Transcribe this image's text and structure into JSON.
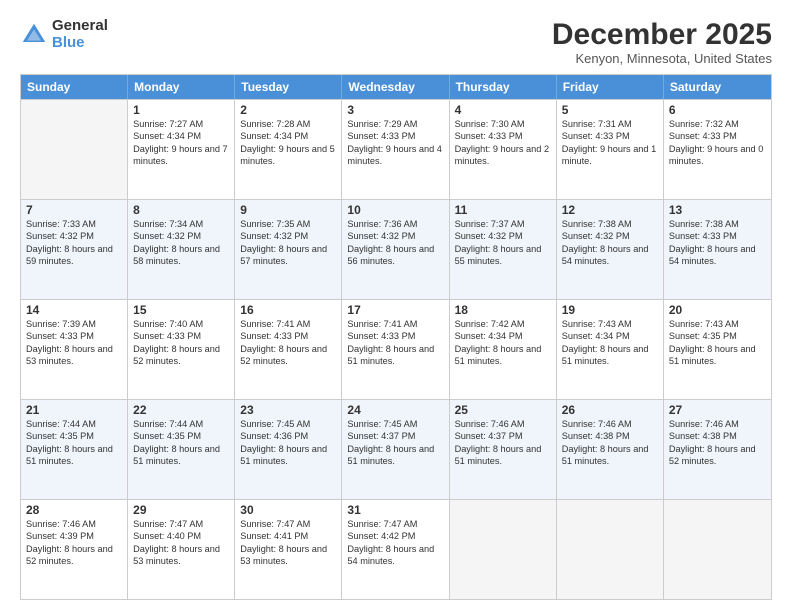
{
  "logo": {
    "general": "General",
    "blue": "Blue"
  },
  "title": "December 2025",
  "location": "Kenyon, Minnesota, United States",
  "days_of_week": [
    "Sunday",
    "Monday",
    "Tuesday",
    "Wednesday",
    "Thursday",
    "Friday",
    "Saturday"
  ],
  "weeks": [
    [
      {
        "day": "",
        "empty": true
      },
      {
        "day": "1",
        "sunrise": "Sunrise: 7:27 AM",
        "sunset": "Sunset: 4:34 PM",
        "daylight": "Daylight: 9 hours and 7 minutes."
      },
      {
        "day": "2",
        "sunrise": "Sunrise: 7:28 AM",
        "sunset": "Sunset: 4:34 PM",
        "daylight": "Daylight: 9 hours and 5 minutes."
      },
      {
        "day": "3",
        "sunrise": "Sunrise: 7:29 AM",
        "sunset": "Sunset: 4:33 PM",
        "daylight": "Daylight: 9 hours and 4 minutes."
      },
      {
        "day": "4",
        "sunrise": "Sunrise: 7:30 AM",
        "sunset": "Sunset: 4:33 PM",
        "daylight": "Daylight: 9 hours and 2 minutes."
      },
      {
        "day": "5",
        "sunrise": "Sunrise: 7:31 AM",
        "sunset": "Sunset: 4:33 PM",
        "daylight": "Daylight: 9 hours and 1 minute."
      },
      {
        "day": "6",
        "sunrise": "Sunrise: 7:32 AM",
        "sunset": "Sunset: 4:33 PM",
        "daylight": "Daylight: 9 hours and 0 minutes."
      }
    ],
    [
      {
        "day": "7",
        "sunrise": "Sunrise: 7:33 AM",
        "sunset": "Sunset: 4:32 PM",
        "daylight": "Daylight: 8 hours and 59 minutes."
      },
      {
        "day": "8",
        "sunrise": "Sunrise: 7:34 AM",
        "sunset": "Sunset: 4:32 PM",
        "daylight": "Daylight: 8 hours and 58 minutes."
      },
      {
        "day": "9",
        "sunrise": "Sunrise: 7:35 AM",
        "sunset": "Sunset: 4:32 PM",
        "daylight": "Daylight: 8 hours and 57 minutes."
      },
      {
        "day": "10",
        "sunrise": "Sunrise: 7:36 AM",
        "sunset": "Sunset: 4:32 PM",
        "daylight": "Daylight: 8 hours and 56 minutes."
      },
      {
        "day": "11",
        "sunrise": "Sunrise: 7:37 AM",
        "sunset": "Sunset: 4:32 PM",
        "daylight": "Daylight: 8 hours and 55 minutes."
      },
      {
        "day": "12",
        "sunrise": "Sunrise: 7:38 AM",
        "sunset": "Sunset: 4:32 PM",
        "daylight": "Daylight: 8 hours and 54 minutes."
      },
      {
        "day": "13",
        "sunrise": "Sunrise: 7:38 AM",
        "sunset": "Sunset: 4:33 PM",
        "daylight": "Daylight: 8 hours and 54 minutes."
      }
    ],
    [
      {
        "day": "14",
        "sunrise": "Sunrise: 7:39 AM",
        "sunset": "Sunset: 4:33 PM",
        "daylight": "Daylight: 8 hours and 53 minutes."
      },
      {
        "day": "15",
        "sunrise": "Sunrise: 7:40 AM",
        "sunset": "Sunset: 4:33 PM",
        "daylight": "Daylight: 8 hours and 52 minutes."
      },
      {
        "day": "16",
        "sunrise": "Sunrise: 7:41 AM",
        "sunset": "Sunset: 4:33 PM",
        "daylight": "Daylight: 8 hours and 52 minutes."
      },
      {
        "day": "17",
        "sunrise": "Sunrise: 7:41 AM",
        "sunset": "Sunset: 4:33 PM",
        "daylight": "Daylight: 8 hours and 51 minutes."
      },
      {
        "day": "18",
        "sunrise": "Sunrise: 7:42 AM",
        "sunset": "Sunset: 4:34 PM",
        "daylight": "Daylight: 8 hours and 51 minutes."
      },
      {
        "day": "19",
        "sunrise": "Sunrise: 7:43 AM",
        "sunset": "Sunset: 4:34 PM",
        "daylight": "Daylight: 8 hours and 51 minutes."
      },
      {
        "day": "20",
        "sunrise": "Sunrise: 7:43 AM",
        "sunset": "Sunset: 4:35 PM",
        "daylight": "Daylight: 8 hours and 51 minutes."
      }
    ],
    [
      {
        "day": "21",
        "sunrise": "Sunrise: 7:44 AM",
        "sunset": "Sunset: 4:35 PM",
        "daylight": "Daylight: 8 hours and 51 minutes."
      },
      {
        "day": "22",
        "sunrise": "Sunrise: 7:44 AM",
        "sunset": "Sunset: 4:35 PM",
        "daylight": "Daylight: 8 hours and 51 minutes."
      },
      {
        "day": "23",
        "sunrise": "Sunrise: 7:45 AM",
        "sunset": "Sunset: 4:36 PM",
        "daylight": "Daylight: 8 hours and 51 minutes."
      },
      {
        "day": "24",
        "sunrise": "Sunrise: 7:45 AM",
        "sunset": "Sunset: 4:37 PM",
        "daylight": "Daylight: 8 hours and 51 minutes."
      },
      {
        "day": "25",
        "sunrise": "Sunrise: 7:46 AM",
        "sunset": "Sunset: 4:37 PM",
        "daylight": "Daylight: 8 hours and 51 minutes."
      },
      {
        "day": "26",
        "sunrise": "Sunrise: 7:46 AM",
        "sunset": "Sunset: 4:38 PM",
        "daylight": "Daylight: 8 hours and 51 minutes."
      },
      {
        "day": "27",
        "sunrise": "Sunrise: 7:46 AM",
        "sunset": "Sunset: 4:38 PM",
        "daylight": "Daylight: 8 hours and 52 minutes."
      }
    ],
    [
      {
        "day": "28",
        "sunrise": "Sunrise: 7:46 AM",
        "sunset": "Sunset: 4:39 PM",
        "daylight": "Daylight: 8 hours and 52 minutes."
      },
      {
        "day": "29",
        "sunrise": "Sunrise: 7:47 AM",
        "sunset": "Sunset: 4:40 PM",
        "daylight": "Daylight: 8 hours and 53 minutes."
      },
      {
        "day": "30",
        "sunrise": "Sunrise: 7:47 AM",
        "sunset": "Sunset: 4:41 PM",
        "daylight": "Daylight: 8 hours and 53 minutes."
      },
      {
        "day": "31",
        "sunrise": "Sunrise: 7:47 AM",
        "sunset": "Sunset: 4:42 PM",
        "daylight": "Daylight: 8 hours and 54 minutes."
      },
      {
        "day": "",
        "empty": true
      },
      {
        "day": "",
        "empty": true
      },
      {
        "day": "",
        "empty": true
      }
    ]
  ]
}
